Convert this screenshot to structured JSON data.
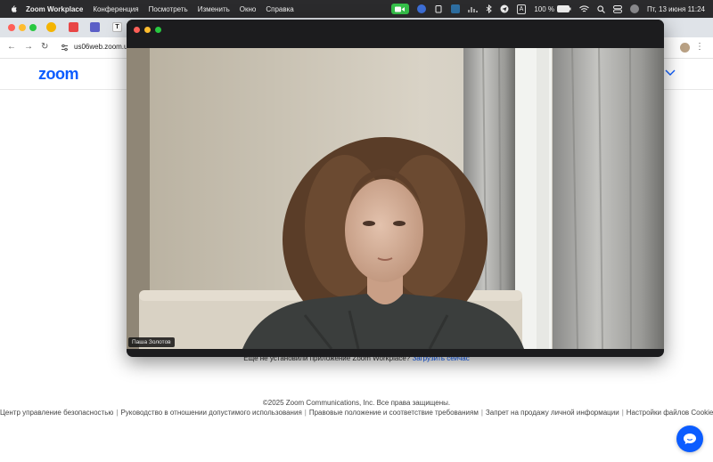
{
  "menubar": {
    "app_name": "Zoom Workplace",
    "items": [
      "Конференция",
      "Посмотреть",
      "Изменить",
      "Окно",
      "Справка"
    ],
    "battery": "100 %",
    "input_source": "A",
    "datetime": "Пт, 13 июня  11:24"
  },
  "browser": {
    "url": "us06web.zoom.u"
  },
  "page": {
    "logo": "zoom",
    "download_prompt": "Еще не установили приложение Zoom Workplace?",
    "download_link": "Загрузить сейчас",
    "copyright": "©2025 Zoom Communications, Inc. Все права защищены.",
    "footer_links": [
      "Центр управление безопасностью",
      "Руководство в отношении допустимого использования",
      "Правовые положение и соответствие требованиям",
      "Запрет на продажу личной информации",
      "Настройки файлов Cookie"
    ]
  },
  "meeting": {
    "participant_name": "Паша Золотов"
  },
  "colors": {
    "zoom_blue": "#0b5cff",
    "zoom_status_green": "#35c04a",
    "menubar_bg": "#2b2b2d"
  }
}
